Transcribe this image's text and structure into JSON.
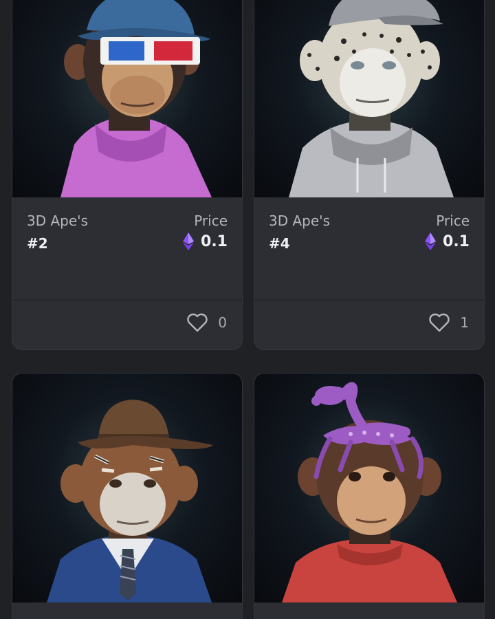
{
  "cards": [
    {
      "collection": "3D Ape's",
      "token": "#2",
      "price_label": "Price",
      "price": "0.1",
      "likes": "0",
      "colors": {
        "hat": "#3b6a9c",
        "glasses_left": "#2e66c9",
        "glasses_right": "#d3283c",
        "hoodie": "#c66bd0"
      }
    },
    {
      "collection": "3D Ape's",
      "token": "#4",
      "price_label": "Price",
      "price": "0.1",
      "likes": "1",
      "colors": {
        "cap": "#9a9ca3",
        "fur": "#d9d4c8",
        "hoodie": "#c9cbd0"
      }
    },
    {
      "colors": {
        "hat": "#6b4a32",
        "fur": "#8a5a3b",
        "suit": "#2b4a8c"
      }
    },
    {
      "colors": {
        "octopus": "#9c5cc4",
        "fur": "#6b4330",
        "sweater": "#c9443e"
      }
    }
  ],
  "theme": {
    "background": "#1f2125",
    "card": "#2c2e34",
    "eth": "#8c52ff"
  }
}
